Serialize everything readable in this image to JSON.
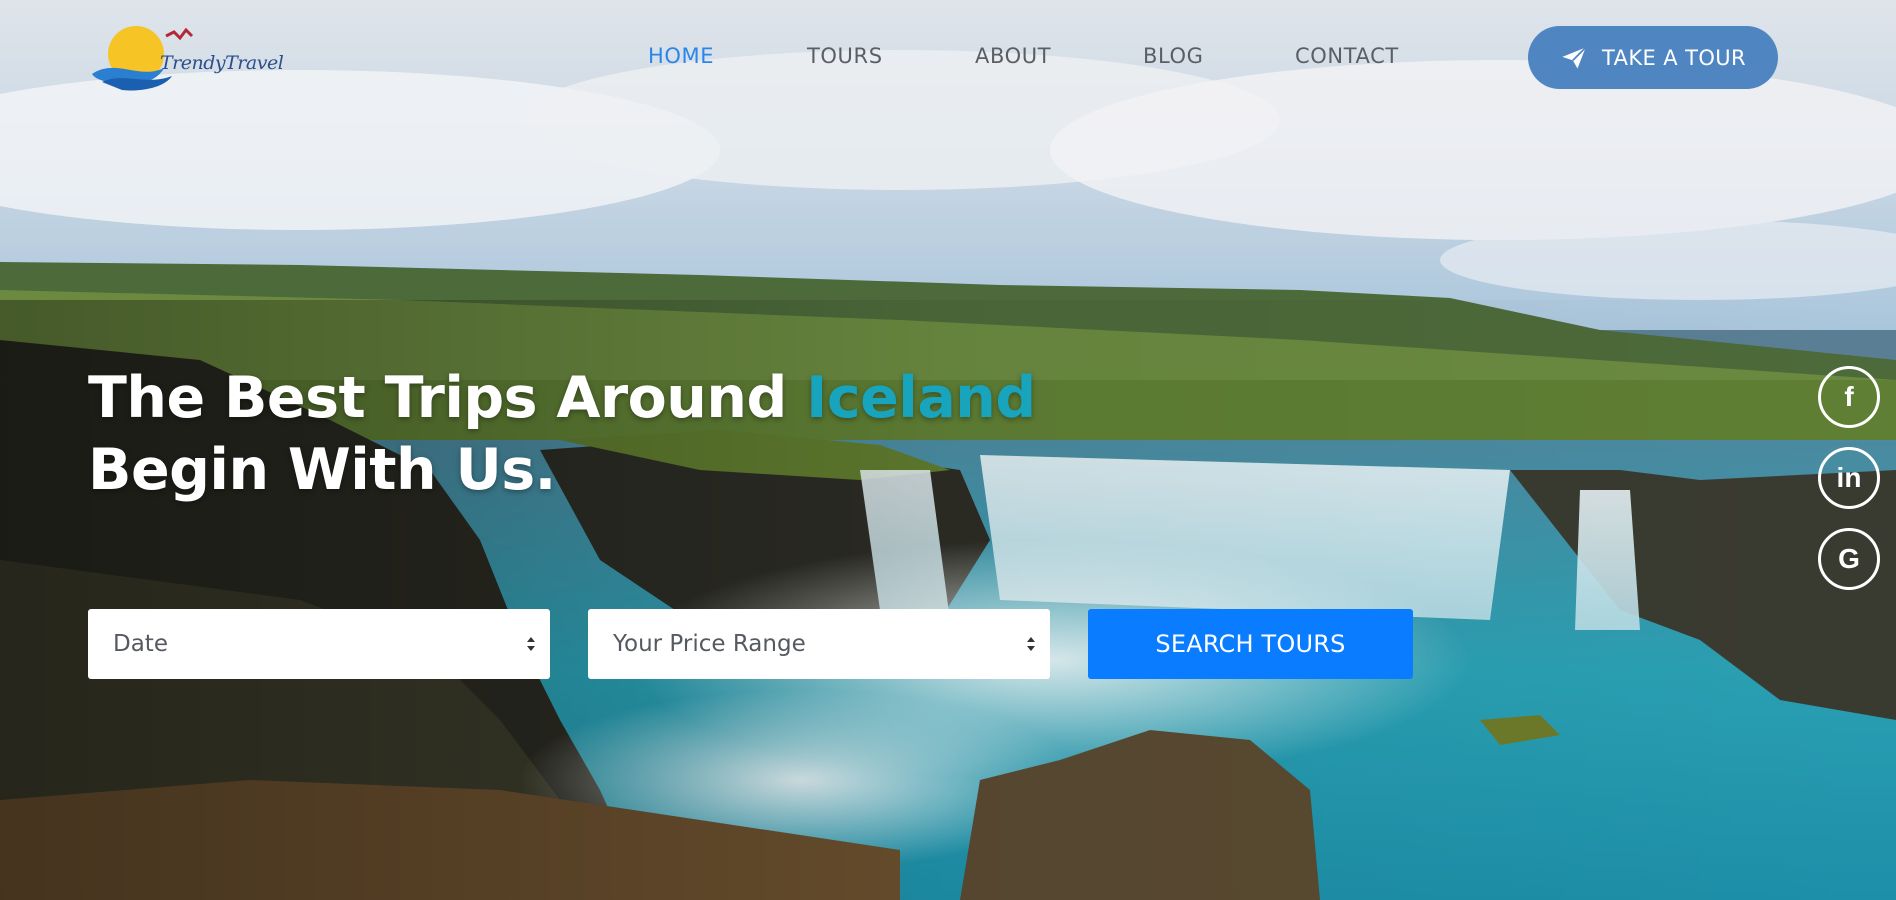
{
  "brand": {
    "name": "TrendyTravel"
  },
  "nav": {
    "items": [
      {
        "label": "HOME",
        "active": true
      },
      {
        "label": "TOURS",
        "active": false
      },
      {
        "label": "ABOUT",
        "active": false
      },
      {
        "label": "BLOG",
        "active": false
      },
      {
        "label": "CONTACT",
        "active": false
      }
    ],
    "cta": {
      "label": "TAKE A TOUR",
      "icon": "paper-plane-icon"
    }
  },
  "hero": {
    "headline_part1": "The Best Trips Around ",
    "headline_accent": "Iceland",
    "headline_line2": "Begin With Us."
  },
  "search": {
    "date_select": "Date",
    "price_select": "Your Price Range",
    "button_label": "SEARCH TOURS"
  },
  "social": [
    {
      "icon": "facebook-icon",
      "glyph": "f"
    },
    {
      "icon": "linkedin-icon",
      "glyph": "in"
    },
    {
      "icon": "google-icon",
      "glyph": "G"
    }
  ],
  "colors": {
    "accent": "#19a4bd",
    "nav_active": "#2a86e8",
    "cta_bg": "#4f86c2",
    "search_button": "#0a7cff"
  }
}
